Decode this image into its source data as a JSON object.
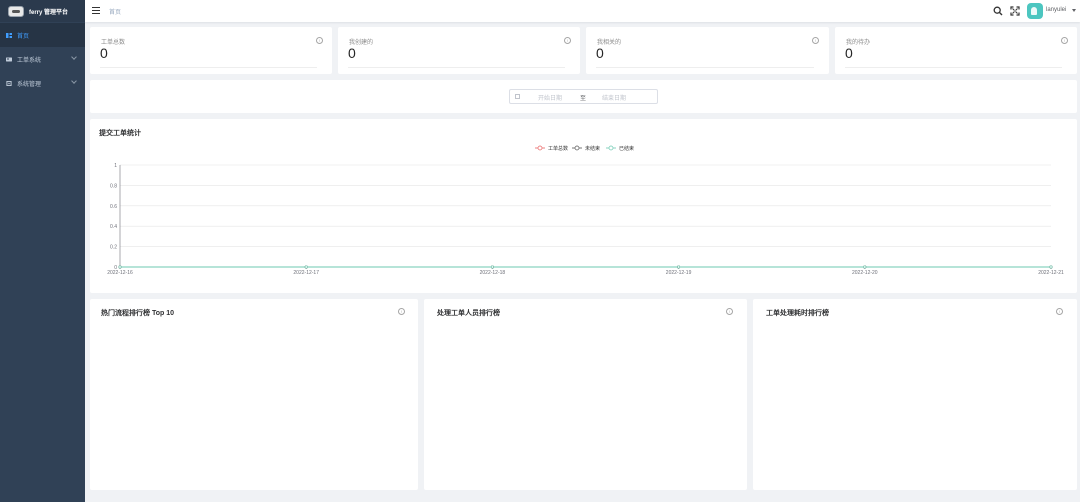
{
  "app": {
    "title": "ferry 管理平台"
  },
  "sidebar": {
    "items": [
      {
        "label": "首页",
        "icon": "dashboard-icon"
      },
      {
        "label": "工单系统",
        "icon": "ticket-icon"
      },
      {
        "label": "系统管理",
        "icon": "settings-icon"
      }
    ]
  },
  "navbar": {
    "breadcrumb": "首页",
    "username": "lanyulei"
  },
  "stats": [
    {
      "label": "工单总数",
      "value": "0"
    },
    {
      "label": "我创建的",
      "value": "0"
    },
    {
      "label": "我相关的",
      "value": "0"
    },
    {
      "label": "我的待办",
      "value": "0"
    }
  ],
  "filter": {
    "start_placeholder": "开始日期",
    "separator": "至",
    "end_placeholder": "结束日期"
  },
  "chart_panel": {
    "title": "提交工单统计"
  },
  "colors": {
    "series_total": "#e86161",
    "series_pending": "#555555",
    "series_done": "#6dc8b0",
    "sidebar": "#304156",
    "accent": "#409eff"
  },
  "chart_data": {
    "type": "line",
    "title": "提交工单统计",
    "x": [
      "2022-12-16",
      "2022-12-17",
      "2022-12-18",
      "2022-12-19",
      "2022-12-20",
      "2022-12-21"
    ],
    "y_ticks": [
      "0",
      "0.2",
      "0.4",
      "0.6",
      "0.8",
      "1"
    ],
    "ylim": [
      0,
      1
    ],
    "legend_position": "top-center",
    "series": [
      {
        "name": "工单总数",
        "values": [
          0,
          0,
          0,
          0,
          0,
          0
        ]
      },
      {
        "name": "未结束",
        "values": [
          0,
          0,
          0,
          0,
          0,
          0
        ]
      },
      {
        "name": "已结束",
        "values": [
          0,
          0,
          0,
          0,
          0,
          0
        ]
      }
    ]
  },
  "rankings": [
    {
      "title": "热门流程排行榜 Top 10"
    },
    {
      "title": "处理工单人员排行榜"
    },
    {
      "title": "工单处理耗时排行榜"
    }
  ]
}
